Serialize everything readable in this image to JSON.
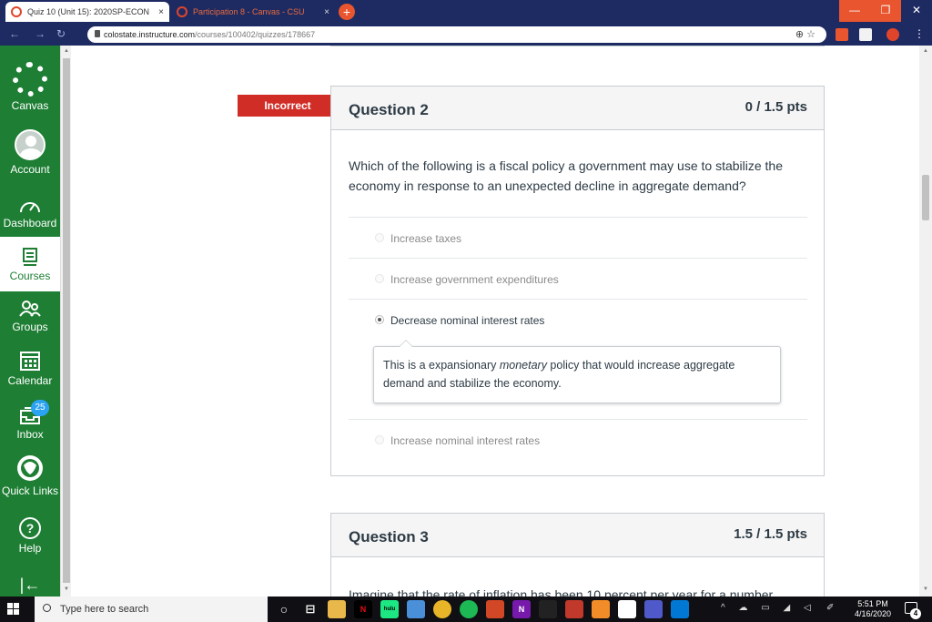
{
  "browser": {
    "tabs": [
      {
        "title": "Quiz 10 (Unit 15): 2020SP-ECON",
        "active": true
      },
      {
        "title": "Participation 8 - Canvas - CSU",
        "active": false
      }
    ],
    "close_glyph": "×",
    "new_tab_glyph": "+",
    "window_controls": {
      "minimize": "—",
      "maximize": "❐",
      "close": "✕"
    },
    "url_host": "colostate.instructure.com",
    "url_path": "/courses/100402/quizzes/178667",
    "omnibox_icons": "⊕ ☆"
  },
  "nav": {
    "items": [
      {
        "label": "Canvas",
        "icon": "canvas-logo-icon"
      },
      {
        "label": "Account",
        "icon": "avatar-icon"
      },
      {
        "label": "Dashboard",
        "icon": "dashboard-icon"
      },
      {
        "label": "Courses",
        "icon": "courses-icon"
      },
      {
        "label": "Groups",
        "icon": "groups-icon"
      },
      {
        "label": "Calendar",
        "icon": "calendar-icon"
      },
      {
        "label": "Inbox",
        "icon": "inbox-icon"
      },
      {
        "label": "Quick Links",
        "icon": "ram-logo-icon"
      },
      {
        "label": "Help",
        "icon": "help-icon"
      }
    ],
    "inbox_badge": "25",
    "collapse_glyph": "|←",
    "help_glyph": "?"
  },
  "question2": {
    "status": "Incorrect",
    "title": "Question 2",
    "points": "0 / 1.5 pts",
    "text": "Which of the following is a fiscal policy a government may use to stabilize the economy in response to an unexpected decline in aggregate demand?",
    "answers": [
      {
        "label": "Increase taxes",
        "selected": false
      },
      {
        "label": "Increase government expenditures",
        "selected": false
      },
      {
        "label": "Decrease nominal interest rates",
        "selected": true
      },
      {
        "label": "Increase nominal interest rates",
        "selected": false
      }
    ],
    "comment_pre": "This is a expansionary ",
    "comment_em": "monetary",
    "comment_post": " policy that would increase aggregate demand and stabilize the economy."
  },
  "question3": {
    "title": "Question 3",
    "points": "1.5 / 1.5 pts",
    "text_partial": "Imagine that the rate of inflation has been 10 percent per year for a number"
  },
  "taskbar": {
    "search_placeholder": "Type here to search",
    "time": "5:51 PM",
    "date": "4/16/2020",
    "notification_count": "4",
    "tray_glyphs": "^ ☁ ▭ ◢ ◁",
    "task_view_glyph": "⊟",
    "cortana_glyph": "○",
    "pen_glyph": "✐"
  }
}
